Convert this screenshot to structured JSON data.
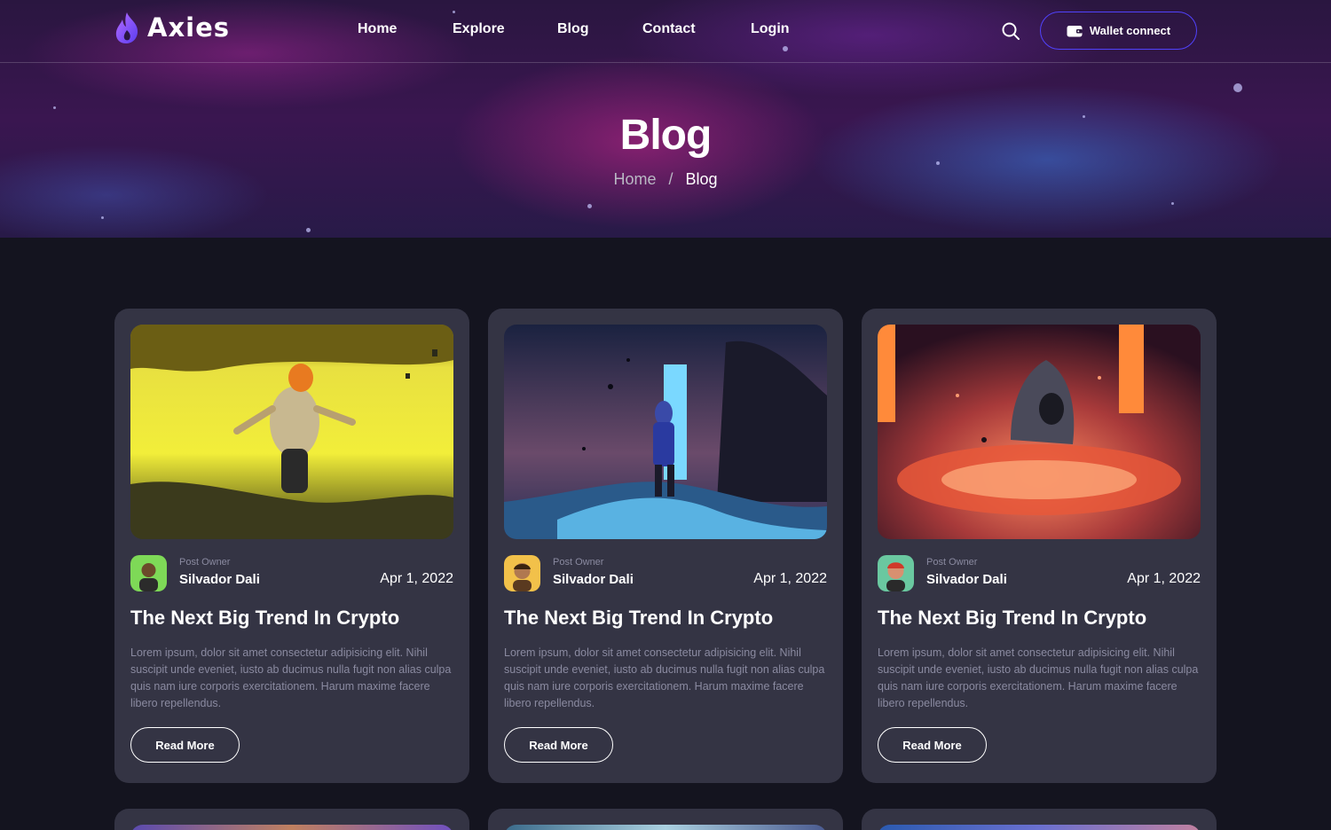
{
  "brand": {
    "name": "Axies"
  },
  "nav": {
    "items": [
      "Home",
      "Explore",
      "Blog",
      "Contact",
      "Login"
    ]
  },
  "header": {
    "wallet_label": "Wallet connect"
  },
  "hero": {
    "title": "Blog",
    "breadcrumb": {
      "home": "Home",
      "separator": "/",
      "current": "Blog"
    }
  },
  "colors": {
    "accent": "#5142fc",
    "card_bg": "#343444",
    "page_bg": "#14141f",
    "muted_text": "#8a8aa0"
  },
  "posts": [
    {
      "owner_label": "Post Owner",
      "owner_name": "Silvador Dali",
      "date": "Apr 1, 2022",
      "title": "The Next Big Trend In Crypto",
      "excerpt": "Lorem ipsum, dolor sit amet consectetur adipisicing elit. Nihil suscipit unde eveniet, iusto ab ducimus nulla fugit non alias culpa quis nam iure corporis exercitationem. Harum maxime facere libero repellendus.",
      "read_more": "Read More"
    },
    {
      "owner_label": "Post Owner",
      "owner_name": "Silvador Dali",
      "date": "Apr 1, 2022",
      "title": "The Next Big Trend In Crypto",
      "excerpt": "Lorem ipsum, dolor sit amet consectetur adipisicing elit. Nihil suscipit unde eveniet, iusto ab ducimus nulla fugit non alias culpa quis nam iure corporis exercitationem. Harum maxime facere libero repellendus.",
      "read_more": "Read More"
    },
    {
      "owner_label": "Post Owner",
      "owner_name": "Silvador Dali",
      "date": "Apr 1, 2022",
      "title": "The Next Big Trend In Crypto",
      "excerpt": "Lorem ipsum, dolor sit amet consectetur adipisicing elit. Nihil suscipit unde eveniet, iusto ab ducimus nulla fugit non alias culpa quis nam iure corporis exercitationem. Harum maxime facere libero repellendus.",
      "read_more": "Read More"
    }
  ]
}
